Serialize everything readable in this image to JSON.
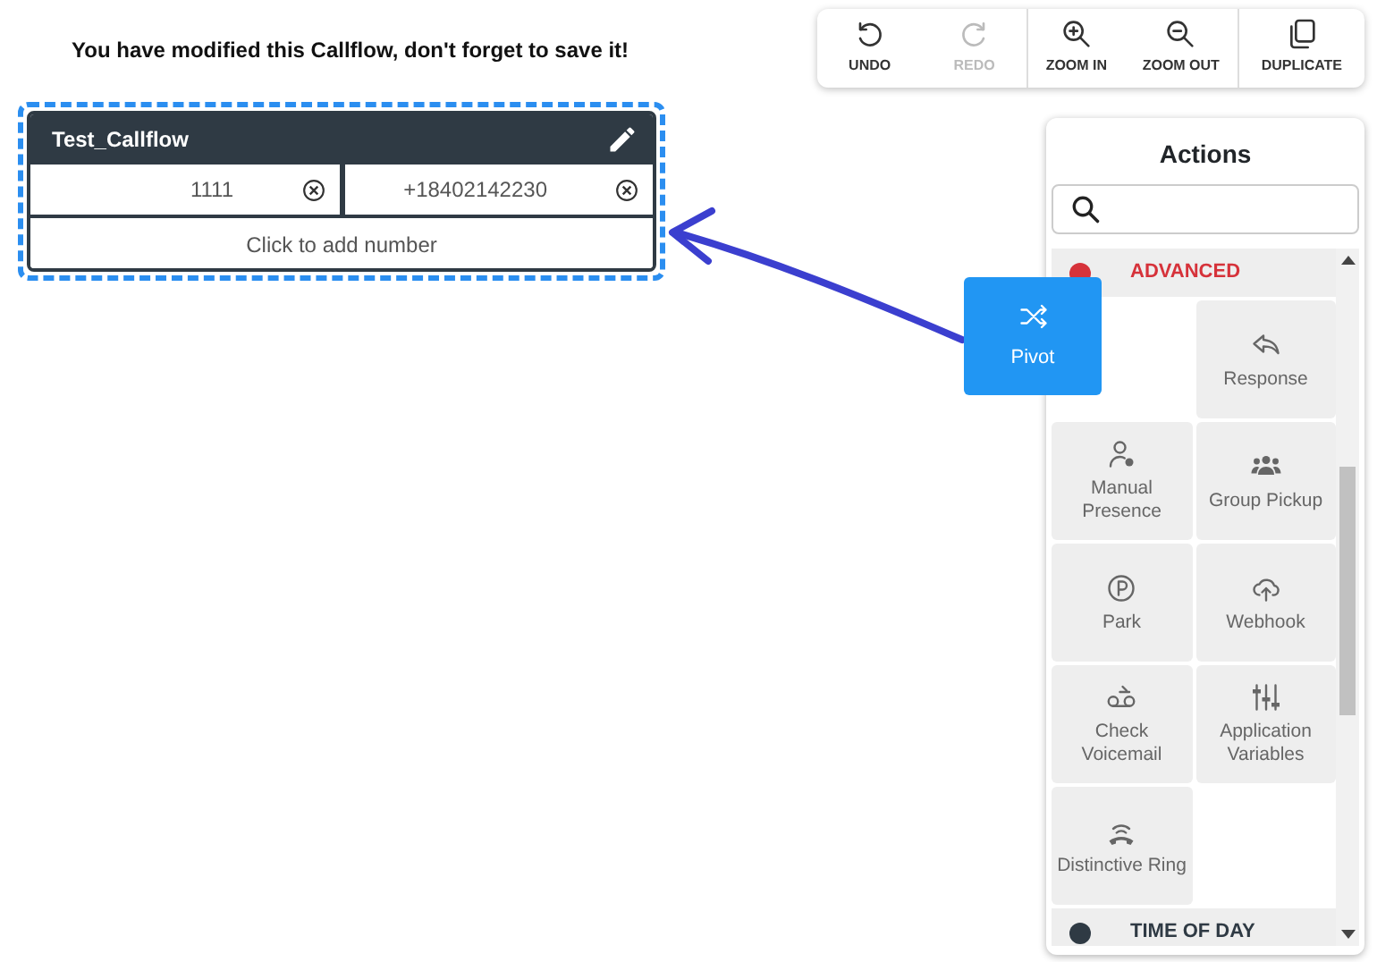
{
  "notice": "You have modified this Callflow, don't forget to save it!",
  "toolbar": {
    "groups": [
      [
        {
          "label": "UNDO",
          "kind": "undo",
          "disabled": false
        },
        {
          "label": "REDO",
          "kind": "redo",
          "disabled": true
        }
      ],
      [
        {
          "label": "ZOOM IN",
          "kind": "zoom-in",
          "disabled": false
        },
        {
          "label": "ZOOM OUT",
          "kind": "zoom-out",
          "disabled": false
        }
      ],
      [
        {
          "label": "DUPLICATE",
          "kind": "duplicate",
          "disabled": false
        }
      ]
    ]
  },
  "callflow": {
    "name": "Test_Callflow",
    "numbers": [
      "1111",
      "+18402142230"
    ],
    "add_label": "Click to add number"
  },
  "actions": {
    "title": "Actions",
    "sections": [
      {
        "title": "ADVANCED",
        "color": "#d6323a",
        "tiles": [
          {
            "label": "Pivot",
            "kind": "shuffle",
            "dragging": true
          },
          {
            "label": "Response",
            "kind": "reply",
            "dragging": false
          },
          {
            "label": "Manual Presence",
            "kind": "person-dot",
            "dragging": false
          },
          {
            "label": "Group Pickup",
            "kind": "people",
            "dragging": false
          },
          {
            "label": "Park",
            "kind": "park",
            "dragging": false
          },
          {
            "label": "Webhook",
            "kind": "cloud-up",
            "dragging": false
          },
          {
            "label": "Check Voicemail",
            "kind": "voicemail",
            "dragging": false
          },
          {
            "label": "Application Variables",
            "kind": "sliders",
            "dragging": false
          },
          {
            "label": "Distinctive Ring",
            "kind": "phone-ring",
            "dragging": false
          }
        ]
      },
      {
        "title": "TIME OF DAY",
        "color": "#2f3a44"
      }
    ]
  }
}
